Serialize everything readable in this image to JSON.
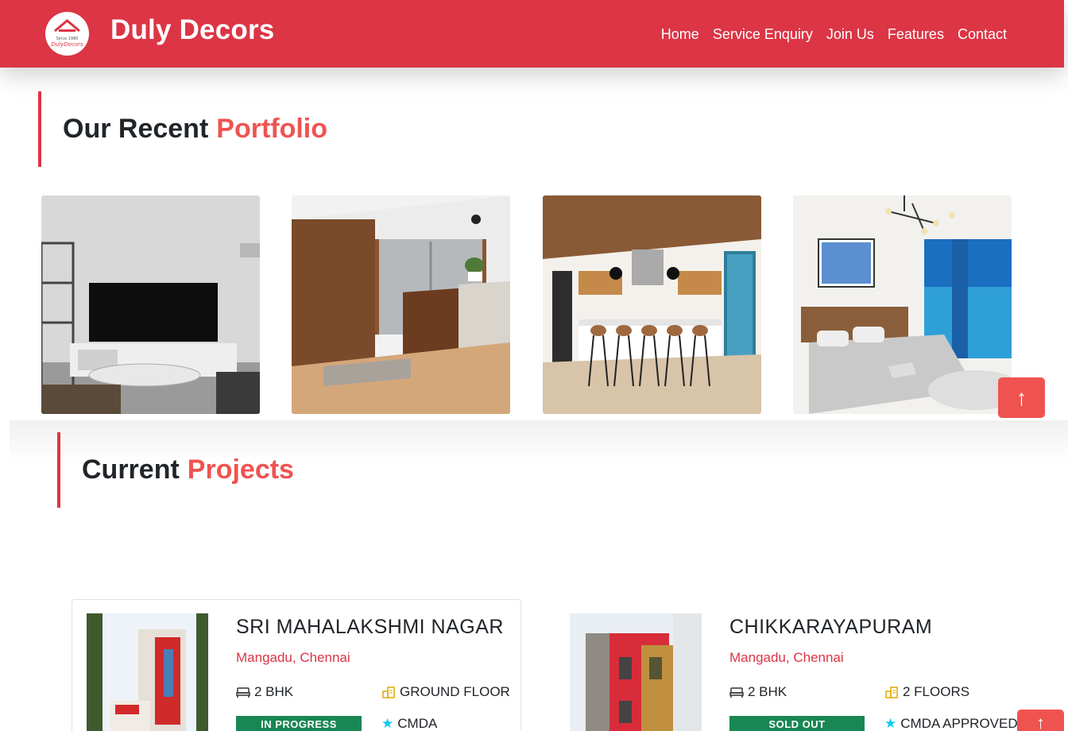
{
  "brand": {
    "name": "Duly Decors",
    "logo_since": "Since 1980",
    "logo_text": "DulyDecors"
  },
  "nav": {
    "items": [
      {
        "label": "Home"
      },
      {
        "label": "Service Enquiry"
      },
      {
        "label": "Join Us"
      },
      {
        "label": "Features"
      },
      {
        "label": "Contact"
      }
    ]
  },
  "portfolio": {
    "title": "Our Recent",
    "title_accent": "Portfolio",
    "images": [
      {
        "subject": "living-room-tv"
      },
      {
        "subject": "wooden-kitchen"
      },
      {
        "subject": "kitchen-bar-stools"
      },
      {
        "subject": "bedroom-blue-wardrobe"
      }
    ]
  },
  "projects": {
    "title": "Current",
    "title_accent": "Projects",
    "items": [
      {
        "name": "SRI MAHALAKSHMI NAGAR",
        "location": "Mangadu, Chennai",
        "spec_1": "2 BHK",
        "spec_2": "GROUND FLOOR",
        "status": "IN  PROGRESS",
        "approval": "CMDA"
      },
      {
        "name": "CHIKKARAYAPURAM",
        "location": "Mangadu, Chennai",
        "spec_1": "2 BHK",
        "spec_2": "2 FLOORS",
        "status": "SOLD OUT",
        "approval": "CMDA APPROVED"
      }
    ]
  },
  "colors": {
    "primary": "#dc3545",
    "accent": "#ef5350",
    "success": "#198754"
  },
  "icons": {
    "back_to_top": "arrow-up-icon",
    "bed": "bed-icon",
    "building": "building-icon",
    "star": "star-icon"
  }
}
